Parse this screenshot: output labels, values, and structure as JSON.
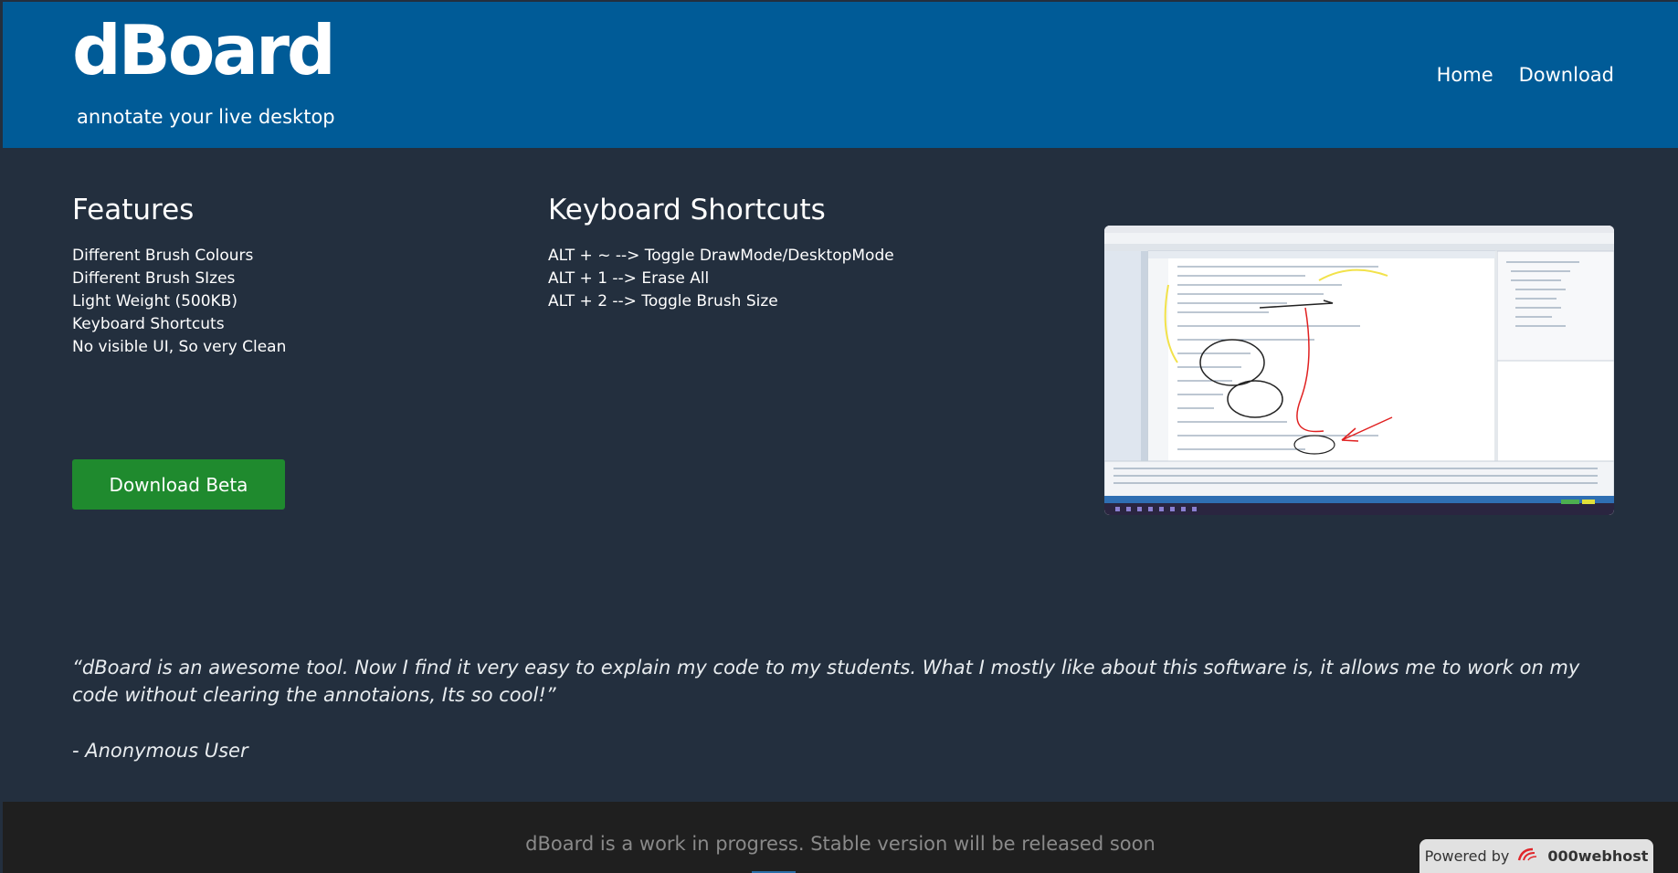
{
  "header": {
    "logo": "dBoard",
    "tagline": "annotate your live desktop",
    "nav": [
      "Home",
      "Download"
    ]
  },
  "features": {
    "title": "Features",
    "items": [
      "Different Brush Colours",
      "Different Brush SIzes",
      "Light Weight (500KB)",
      "Keyboard Shortcuts",
      "No visible UI, So very Clean"
    ],
    "download_button": "Download Beta"
  },
  "shortcuts": {
    "title": "Keyboard Shortcuts",
    "items": [
      "ALT + ~ --> Toggle DrawMode/DesktopMode",
      "ALT + 1 --> Erase All",
      "ALT + 2 --> Toggle Brush Size"
    ]
  },
  "testimonial": {
    "quote": "“dBoard is an awesome tool. Now I find it very easy to explain my code to my students. What I mostly like about this software is, it allows me to work on my code without clearing the annotaions, Its so cool!”",
    "author": "- Anonymous User"
  },
  "footer": {
    "text": "dBoard is a work in progress. Stable version will be released soon"
  },
  "badge": {
    "prefix": "Powered by",
    "brand": "000webhost"
  },
  "colors": {
    "header": "#005b97",
    "body": "#232f3e",
    "button": "#1f8a2e",
    "footer": "#1f1f1f"
  }
}
